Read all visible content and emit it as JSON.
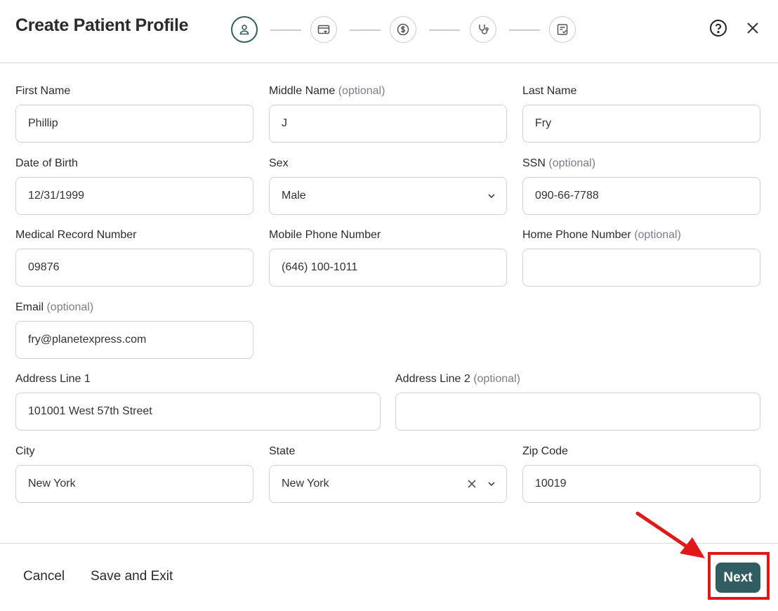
{
  "header": {
    "title": "Create Patient Profile",
    "steps": [
      {
        "icon": "user-icon",
        "active": true
      },
      {
        "icon": "card-heart-icon",
        "active": false
      },
      {
        "icon": "dollar-icon",
        "active": false
      },
      {
        "icon": "stethoscope-icon",
        "active": false
      },
      {
        "icon": "checklist-icon",
        "active": false
      }
    ],
    "help_icon": "question-circle-icon",
    "close_icon": "close-icon"
  },
  "optional_tag": "(optional)",
  "form": {
    "first_name": {
      "label": "First Name",
      "value": "Phillip"
    },
    "middle_name": {
      "label": "Middle Name",
      "value": "J"
    },
    "last_name": {
      "label": "Last Name",
      "value": "Fry"
    },
    "dob": {
      "label": "Date of Birth",
      "value": "12/31/1999"
    },
    "sex": {
      "label": "Sex",
      "value": "Male"
    },
    "ssn": {
      "label": "SSN",
      "value": "090-66-7788"
    },
    "mrn": {
      "label": "Medical Record Number",
      "value": "09876"
    },
    "mobile": {
      "label": "Mobile Phone Number",
      "value": "(646) 100-1011"
    },
    "home_phone": {
      "label": "Home Phone Number",
      "value": ""
    },
    "email": {
      "label": "Email",
      "value": "fry@planetexpress.com"
    },
    "address1": {
      "label": "Address Line 1",
      "value": "101001 West 57th Street"
    },
    "address2": {
      "label": "Address Line 2",
      "value": ""
    },
    "city": {
      "label": "City",
      "value": "New York"
    },
    "state": {
      "label": "State",
      "value": "New York"
    },
    "zip": {
      "label": "Zip Code",
      "value": "10019"
    }
  },
  "footer": {
    "cancel": "Cancel",
    "save_exit": "Save and Exit",
    "next": "Next"
  },
  "colors": {
    "accent": "#2f5d62",
    "annotation": "#e01818"
  }
}
